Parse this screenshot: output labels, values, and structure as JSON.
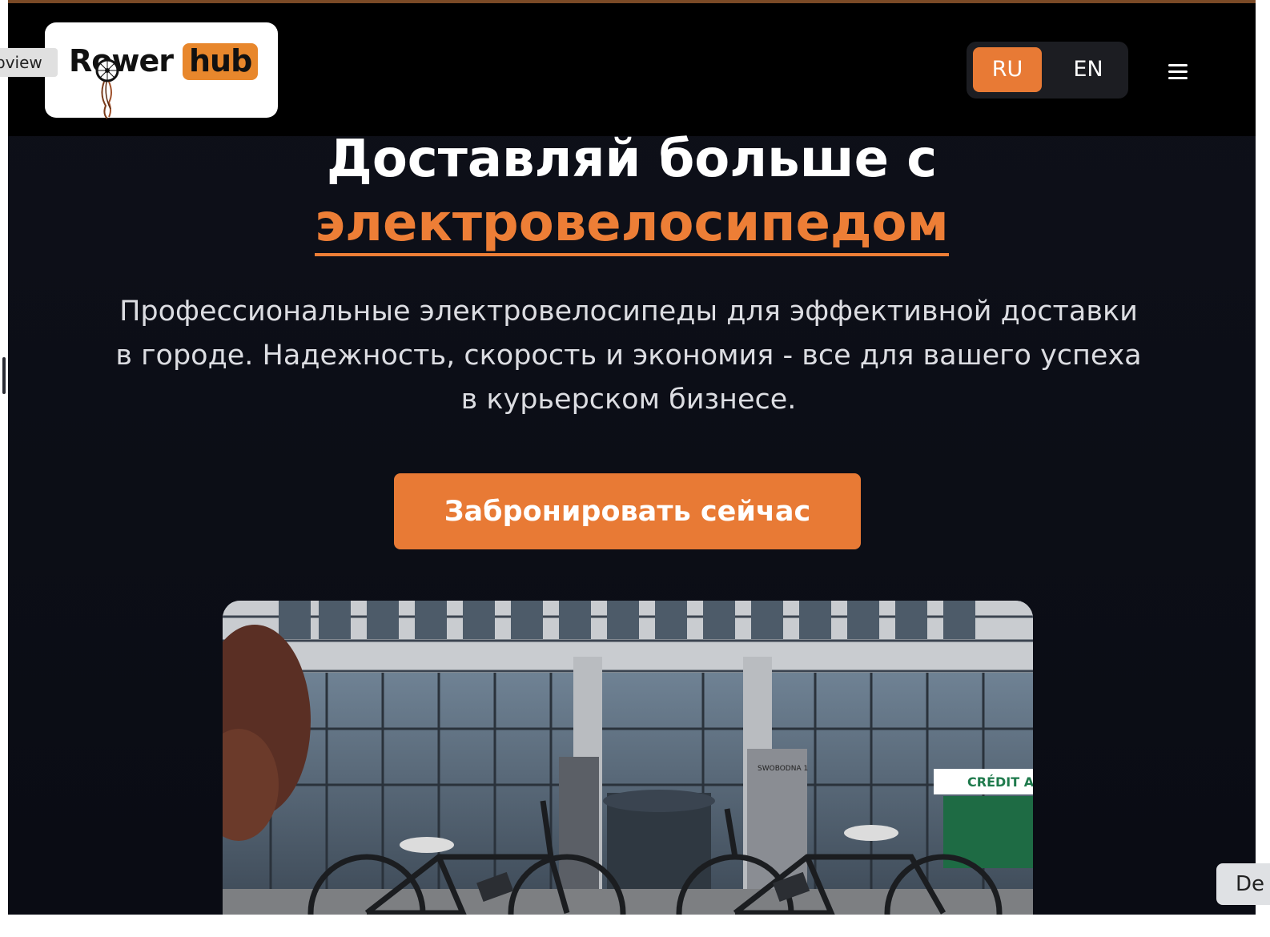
{
  "brand": {
    "name_part1": "Rower",
    "name_part2": "hub",
    "accent_color": "#e87a35"
  },
  "header": {
    "languages": [
      {
        "code": "RU",
        "active": true
      },
      {
        "code": "EN",
        "active": false
      }
    ],
    "menu_icon": "hamburger-icon"
  },
  "hero": {
    "title": "Доставляй больше с",
    "title_accent": "электровелосипедом",
    "subtitle": "Профессиональные электровелосипеды для эффективной доставки в городе. Надежность, скорость и экономия - все для вашего успеха в курьерском бизнесе.",
    "cta_label": "Забронировать сейчас",
    "image_signs": {
      "building_sign": "SWOBODNA 1",
      "bank_sign": "CRÉDIT AG"
    }
  },
  "overlay": {
    "side_tab_label": "bview",
    "corner_button_label": "De"
  }
}
